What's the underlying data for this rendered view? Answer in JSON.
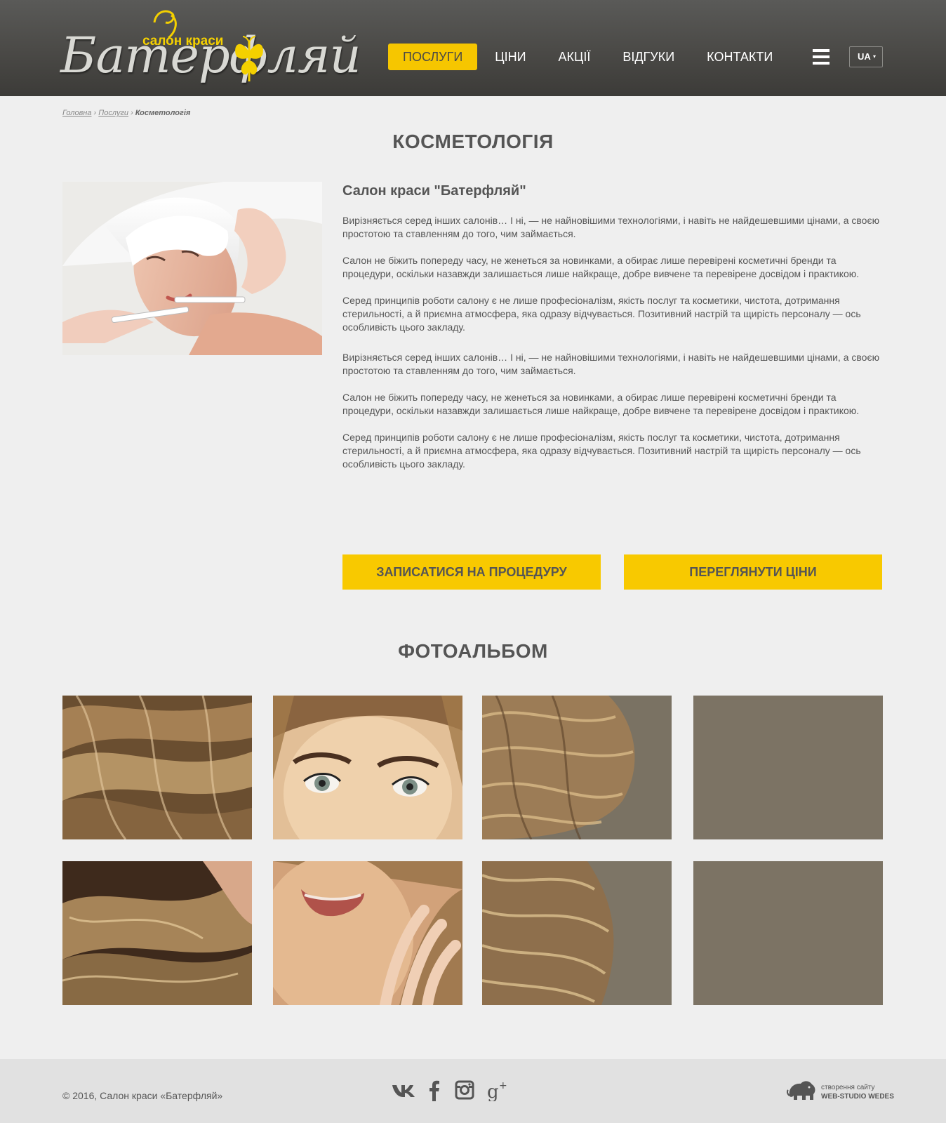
{
  "header": {
    "logo_script": "Батерфляй",
    "logo_tagline": "салон краси",
    "nav": [
      {
        "label": "ПОСЛУГИ",
        "active": true
      },
      {
        "label": "ЦІНИ",
        "active": false
      },
      {
        "label": "АКЦІЇ",
        "active": false
      },
      {
        "label": "ВІДГУКИ",
        "active": false
      },
      {
        "label": "КОНТАКТИ",
        "active": false
      }
    ],
    "menu_icon": "hamburger-icon",
    "language": "UA"
  },
  "breadcrumb": {
    "home": "Головна",
    "section": "Послуги",
    "current": "Косметологія",
    "separator": "›"
  },
  "page_title": "КОСМЕТОЛОГІЯ",
  "article": {
    "heading": "Салон краси \"Батерфляй\"",
    "paragraphs": [
      "Вирізняється серед інших салонів… І ні, — не найновішими технологіями, і навіть не найдешевшими цінами, а своєю простотою та ставленням до того, чим займається.",
      "Салон не біжить попереду часу, не жeнеться за новинками, а обирає лише перевірені косметичні бренди та процедури, оскільки назавжди залишається лише найкраще, добре вивчене та перевірене досвідом і практикою.",
      "Серед принципів роботи салону є не лише професіоналізм, якість послуг та косметики, чистота, дотримання стерильності, а й приємна атмосфера, яка одразу відчувається. Позитивний настрій та щирість персоналу — ось особливість цього закладу.",
      "Вирізняється серед інших салонів… І ні, — не найновішими технологіями, і навіть не найдешевшими цінами, а своєю простотою та ставленням до того, чим займається.",
      "Салон не біжить попереду часу, не жeнеться за новинками, а обирає лише перевірені косметичні бренди та процедури, оскільки назавжди залишається лише найкраще, добре вивчене та перевірене досвідом і практикою.",
      "Серед принципів роботи салону є не лише професіоналізм, якість послуг та косметики, чистота, дотримання стерильності, а й приємна атмосфера, яка одразу відчувається. Позитивний настрій та щирість персоналу — ось особливість цього закладу."
    ]
  },
  "buttons": {
    "book": "ЗАПИСАТИСЯ НА ПРОЦЕДУРУ",
    "prices": "ПЕРЕГЛЯНУТИ ЦІНИ"
  },
  "album": {
    "title": "ФОТОАЛЬБОМ"
  },
  "footer": {
    "copyright": "© 2016, Салон краси «Батерфляй»",
    "social": [
      "vk-icon",
      "facebook-icon",
      "instagram-icon",
      "google-plus-icon"
    ],
    "studio_line1": "створення сайту",
    "studio_line2": "WEB-STUDIO WEDES"
  },
  "colors": {
    "accent": "#f8c900",
    "header_bg": "#4a4946",
    "page_bg": "#efefef",
    "footer_bg": "#e1e1e1",
    "text": "#555555"
  }
}
